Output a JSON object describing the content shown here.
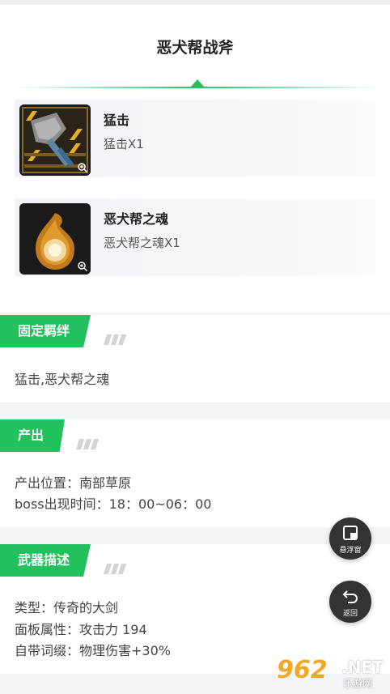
{
  "page": {
    "title": "恶犬帮战斧"
  },
  "materials": [
    {
      "name": "猛击",
      "quantity": "猛击X1",
      "icon": "axe-icon"
    },
    {
      "name": "恶犬帮之魂",
      "quantity": "恶犬帮之魂X1",
      "icon": "soul-orb-icon"
    }
  ],
  "sections": {
    "bond": {
      "title": "固定羁绊",
      "lines": [
        "猛击,恶犬帮之魂"
      ]
    },
    "source": {
      "title": "产出",
      "lines": [
        "产出位置：南部草原",
        "boss出现时间：18：00~06：00"
      ]
    },
    "desc": {
      "title": "武器描述",
      "lines": [
        "类型：传奇的大剑",
        "面板属性：攻击力 194",
        "自带词缀：物理伤害+30%"
      ]
    }
  },
  "floating": {
    "float_label": "悬浮窗",
    "back_label": "返回"
  },
  "watermark": {
    "number": "962",
    "suffix": ".NET",
    "site": "乐游网"
  },
  "colors": {
    "accent": "#22c15e",
    "card": "#ffffff",
    "background": "#f3f4f6",
    "float_btn": "#333333"
  }
}
